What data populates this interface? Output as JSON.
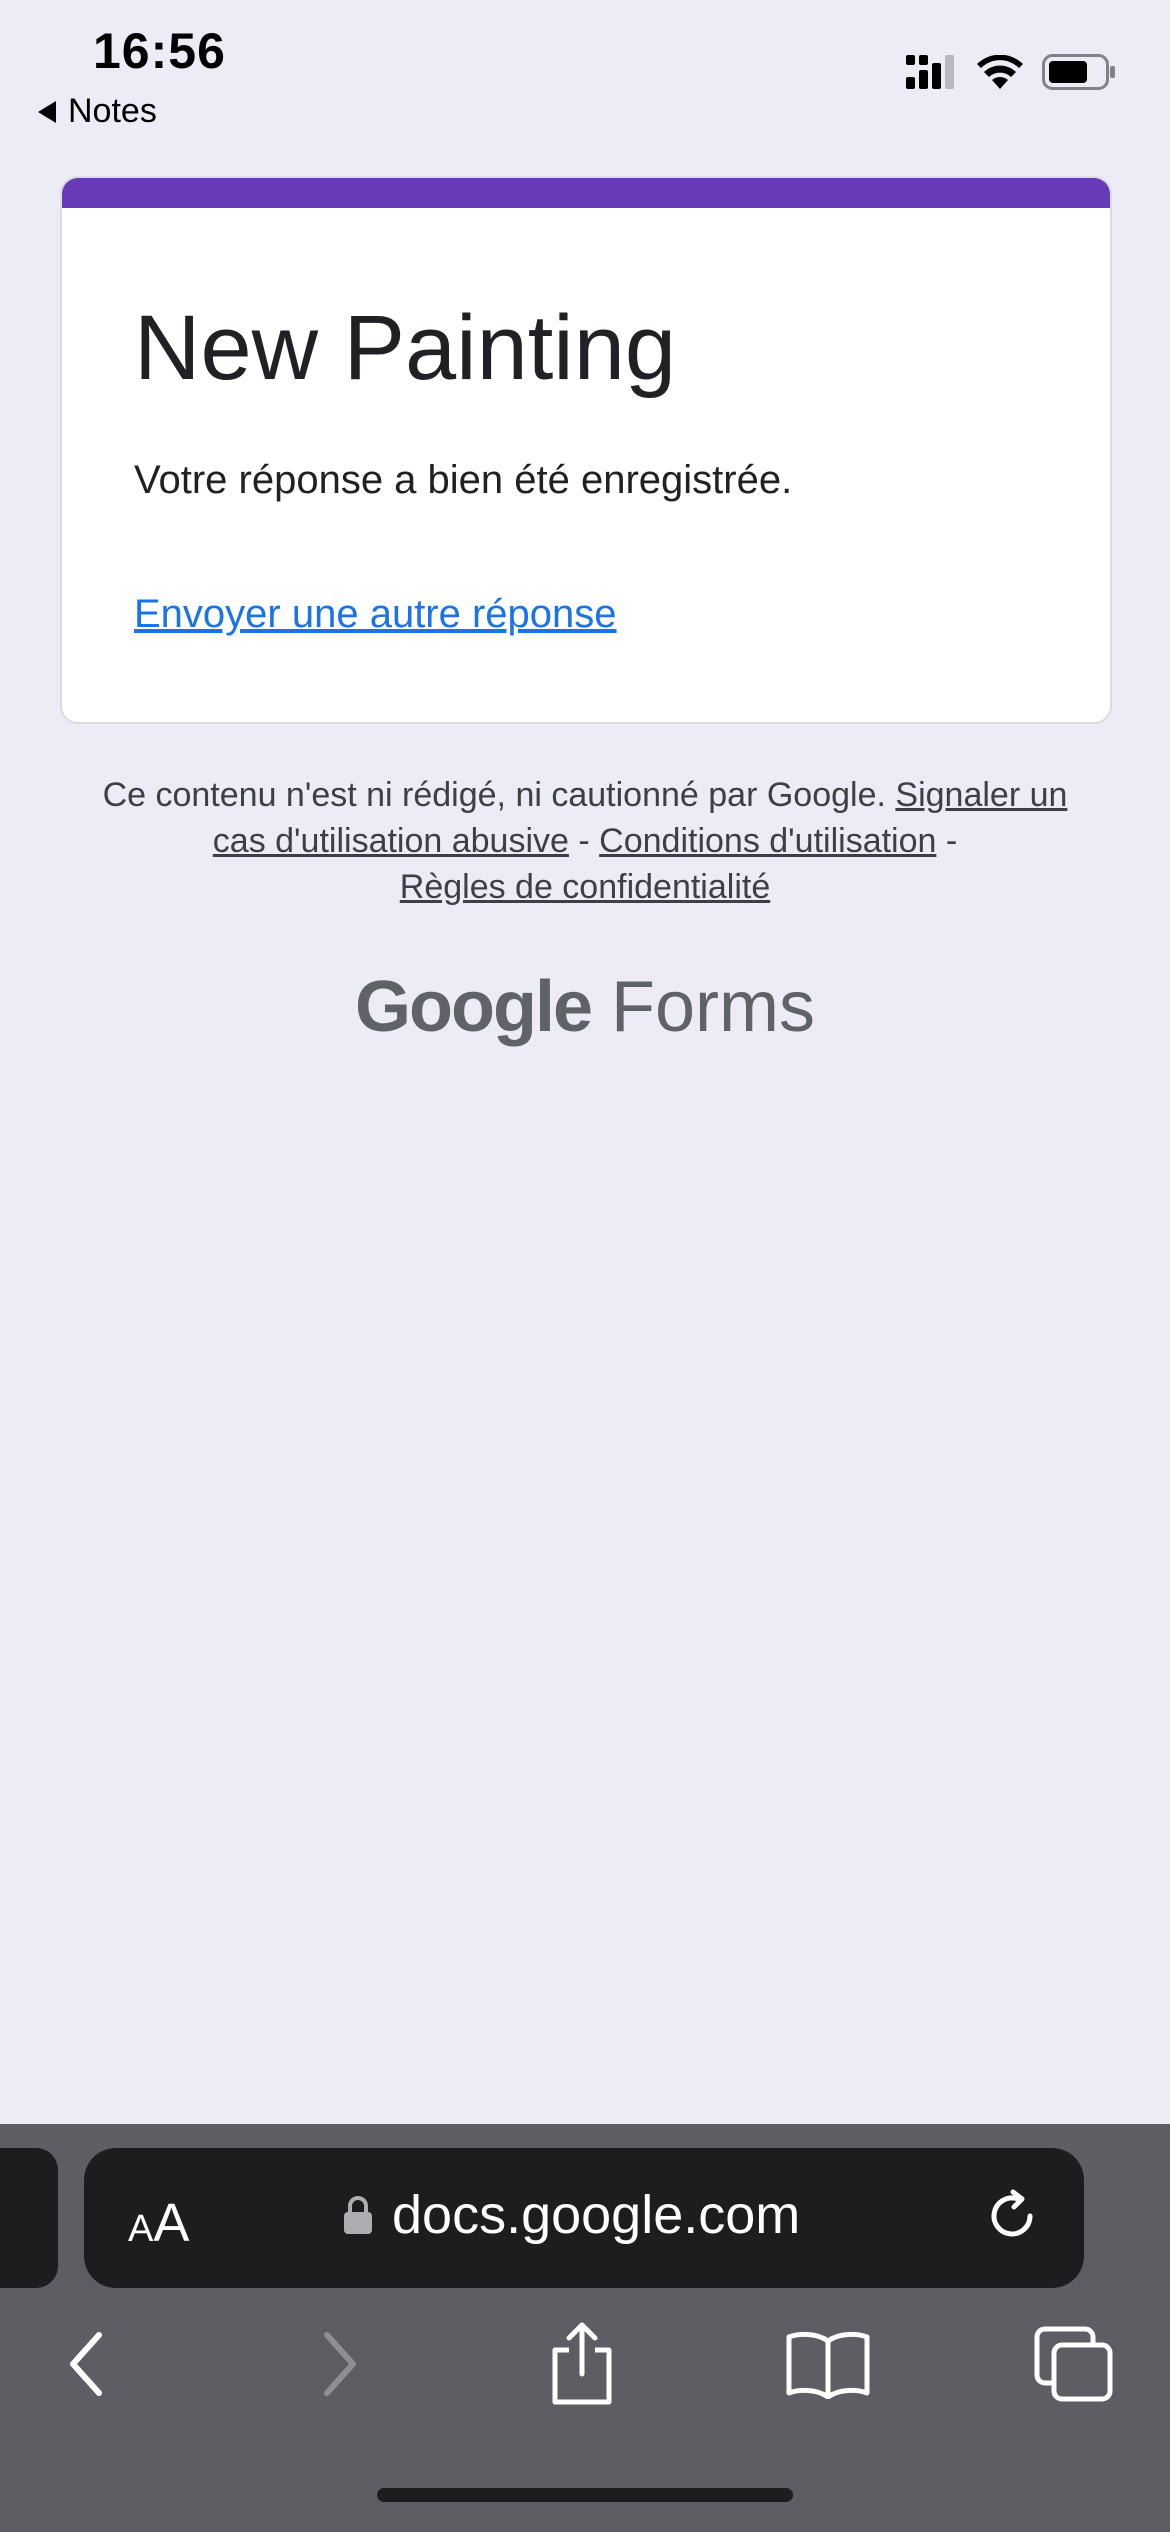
{
  "status_bar": {
    "time": "16:56",
    "back_app": "Notes",
    "icons": [
      "cellular-signal-icon",
      "wifi-icon",
      "battery-icon"
    ]
  },
  "form": {
    "title": "New Painting",
    "message": "Votre réponse a bien été enregistrée.",
    "link": "Envoyer une autre réponse",
    "accent_color": "#673ab7",
    "link_color": "#1a73e8"
  },
  "footer": {
    "disclaimer_text": "Ce contenu n'est ni rédigé, ni cautionné par Google.",
    "report_link": "Signaler un cas d'utilisation abusive",
    "separator": "-",
    "terms_link": "Conditions d'utilisation",
    "privacy_link": "Règles de confidentialité",
    "brand_google": "Google",
    "brand_product": "Forms"
  },
  "browser": {
    "text_size_small": "A",
    "text_size_big": "A",
    "url": "docs.google.com",
    "toolbar": [
      "back-icon",
      "forward-icon",
      "share-icon",
      "bookmarks-icon",
      "tabs-icon"
    ]
  }
}
